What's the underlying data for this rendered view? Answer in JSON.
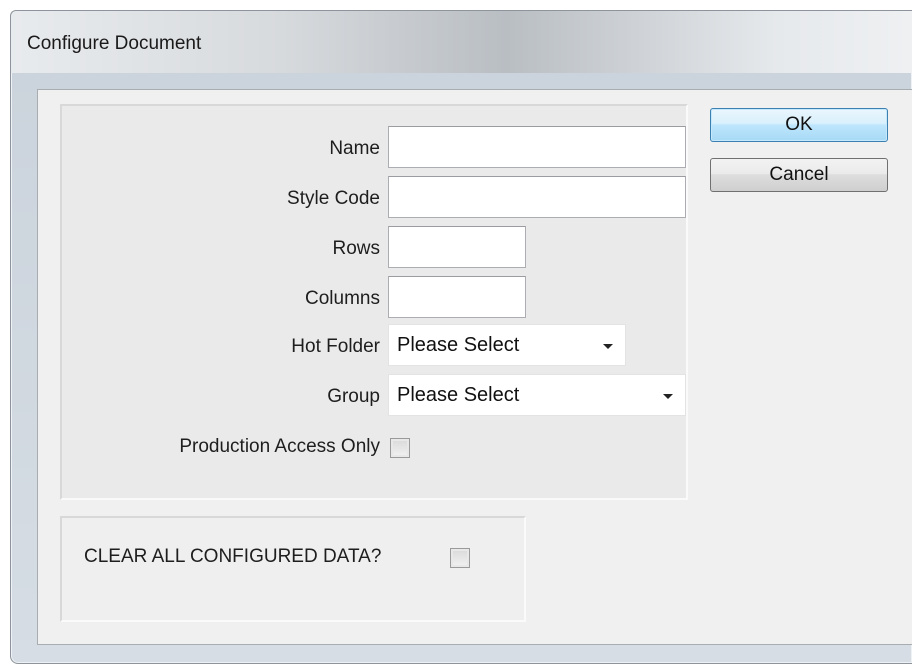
{
  "window": {
    "title": "Configure Document"
  },
  "buttons": {
    "ok": "OK",
    "cancel": "Cancel"
  },
  "form": {
    "name_label": "Name",
    "name_value": "",
    "style_code_label": "Style Code",
    "style_code_value": "",
    "rows_label": "Rows",
    "rows_value": "",
    "columns_label": "Columns",
    "columns_value": "",
    "hot_folder_label": "Hot Folder",
    "hot_folder_value": "Please Select",
    "group_label": "Group",
    "group_value": "Please Select",
    "production_access_label": "Production Access Only",
    "production_access_checked": false
  },
  "clear": {
    "label": "CLEAR ALL CONFIGURED DATA?",
    "checked": false
  }
}
